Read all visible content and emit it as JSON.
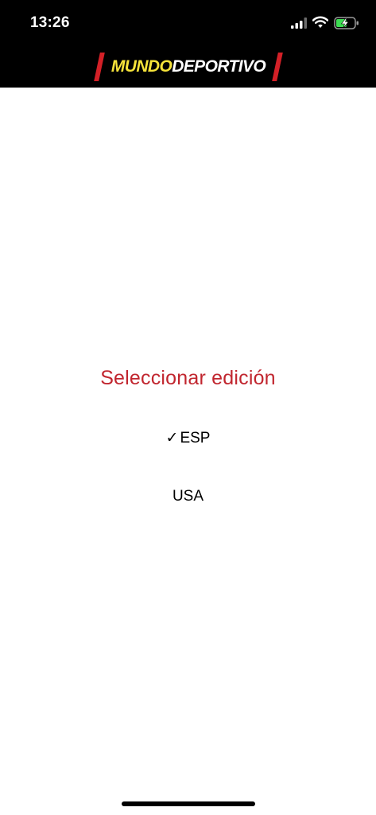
{
  "status_bar": {
    "time": "13:26",
    "icons": [
      "signal-icon",
      "wifi-icon",
      "battery-charging-icon"
    ]
  },
  "header": {
    "logo_part1": "MUNDO",
    "logo_part2": "DEPORTIVO",
    "logo_colors": {
      "mundo": "#f6e33a",
      "deportivo": "#ffffff",
      "bars": "#d32027",
      "background": "#000000"
    }
  },
  "edition_picker": {
    "title": "Seleccionar edición",
    "title_color": "#c1262f",
    "options": [
      {
        "label": "ESP",
        "selected": true,
        "check": "✓"
      },
      {
        "label": "USA",
        "selected": false,
        "check": ""
      }
    ]
  }
}
